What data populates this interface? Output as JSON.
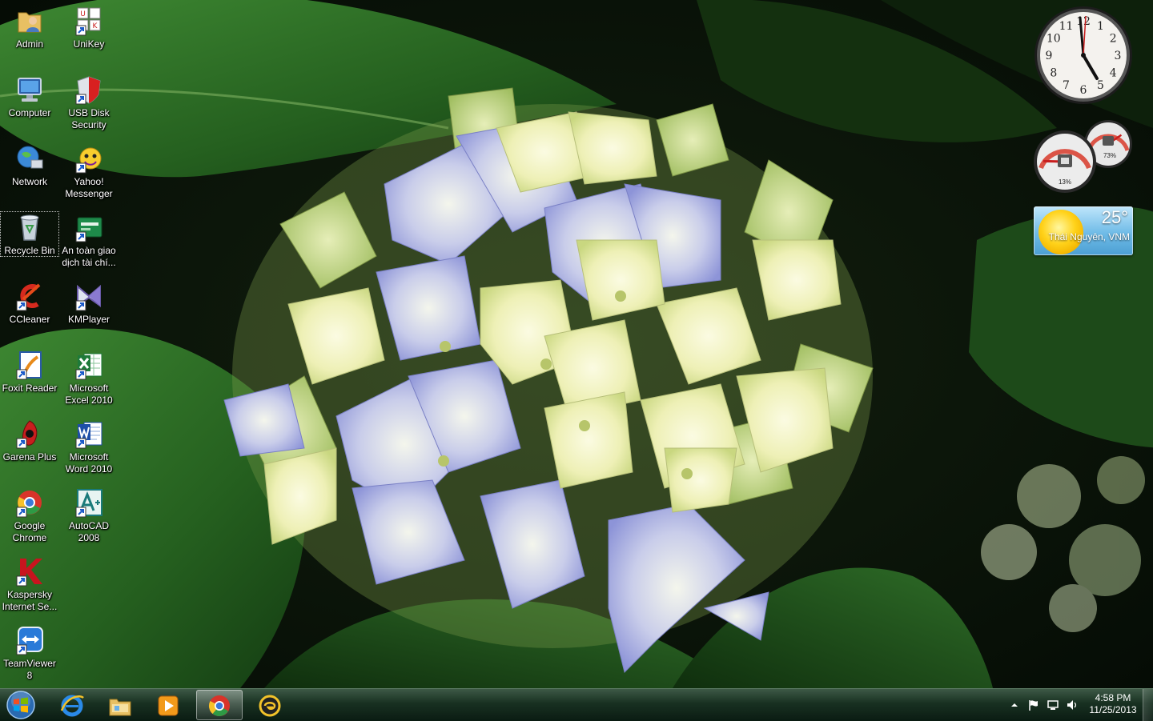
{
  "desktop_icons": {
    "admin": "Admin",
    "unikey": "UniKey",
    "computer": "Computer",
    "usb_disk_security": "USB Disk\nSecurity",
    "network": "Network",
    "yahoo_messenger": "Yahoo!\nMessenger",
    "recycle_bin": "Recycle Bin",
    "an_toan_giao_dich": "An toàn giao\ndịch tài chí...",
    "ccleaner": "CCleaner",
    "kmplayer": "KMPlayer",
    "foxit_reader": "Foxit Reader",
    "excel": "Microsoft\nExcel 2010",
    "garena_plus": "Garena Plus",
    "word": "Microsoft\nWord 2010",
    "google_chrome": "Google\nChrome",
    "autocad": "AutoCAD\n2008",
    "kaspersky": "Kaspersky\nInternet Se...",
    "teamviewer": "TeamViewer\n8"
  },
  "gadgets": {
    "clock_numbers": [
      "12",
      "1",
      "2",
      "3",
      "4",
      "5",
      "6",
      "7",
      "8",
      "9",
      "10",
      "11"
    ],
    "cpu_meter": {
      "cpu_percent": "13%",
      "memory_percent": "73%",
      "cpu_value": 13,
      "memory_value": 73
    },
    "weather": {
      "temperature": "25°",
      "location": "Thái Nguyên, VNM"
    }
  },
  "taskbar": {
    "pinned": [
      "internet-explorer-icon",
      "windows-explorer-icon",
      "media-player-icon",
      "google-chrome-icon",
      "garena-icon"
    ],
    "active": "google-chrome-icon",
    "clock_time": "4:58 PM",
    "clock_date": "11/25/2013"
  },
  "colors": {
    "taskbar": "#1c3a28",
    "weather_sky": "#6fbbe7",
    "sun": "#ffd21a"
  }
}
